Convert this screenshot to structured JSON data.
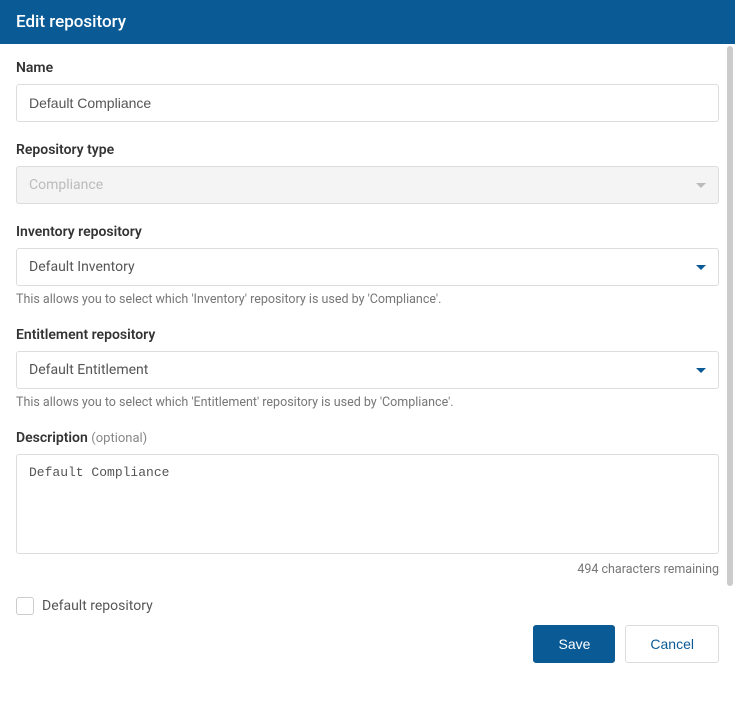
{
  "header": {
    "title": "Edit repository"
  },
  "form": {
    "name": {
      "label": "Name",
      "value": "Default Compliance"
    },
    "repository_type": {
      "label": "Repository type",
      "value": "Compliance"
    },
    "inventory_repository": {
      "label": "Inventory repository",
      "value": "Default Inventory",
      "help": "This allows you to select which 'Inventory' repository is used by 'Compliance'."
    },
    "entitlement_repository": {
      "label": "Entitlement repository",
      "value": "Default Entitlement",
      "help": "This allows you to select which 'Entitlement' repository is used by 'Compliance'."
    },
    "description": {
      "label": "Description",
      "optional": "(optional)",
      "value": "Default Compliance",
      "counter": "494 characters remaining"
    },
    "default_repo": {
      "label": "Default repository",
      "checked": false
    }
  },
  "buttons": {
    "save": "Save",
    "cancel": "Cancel"
  }
}
